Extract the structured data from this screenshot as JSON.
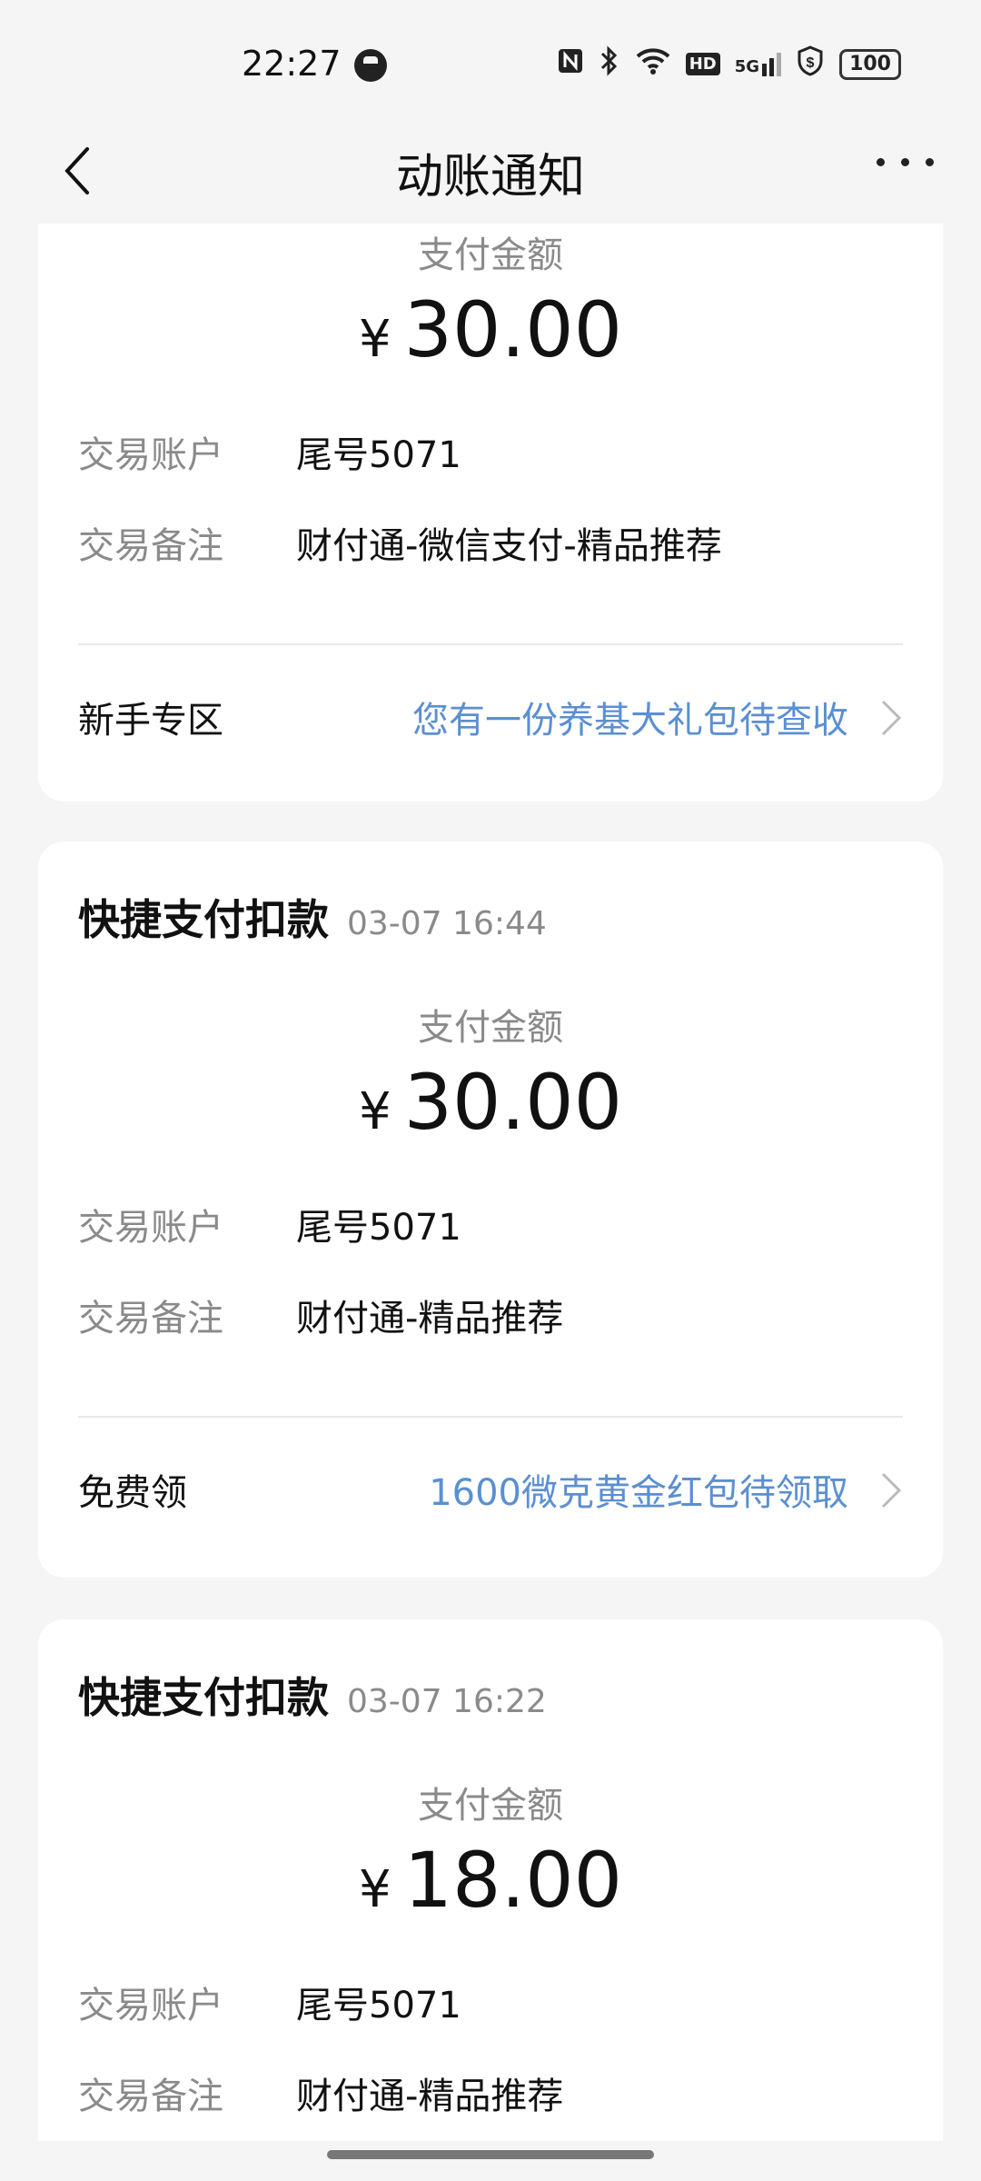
{
  "status_bar": {
    "time": "22:27",
    "icons": [
      "nfc-icon",
      "bluetooth-icon",
      "wifi-icon",
      "hd-icon",
      "5g-signal-icon",
      "shield-dollar-icon",
      "battery-icon"
    ],
    "hd_label": "HD",
    "signal_label": "5G",
    "battery": "100"
  },
  "nav": {
    "title": "动账通知"
  },
  "cards": [
    {
      "amount_label": "支付金额",
      "currency": "¥",
      "amount": "30.00",
      "account_label": "交易账户",
      "account_value": "尾号5071",
      "note_label": "交易备注",
      "note_value": "财付通-微信支付-精品推荐",
      "promo_label": "新手专区",
      "promo_text": "您有一份养基大礼包待查收"
    },
    {
      "type": "快捷支付扣款",
      "time": "03-07 16:44",
      "amount_label": "支付金额",
      "currency": "¥",
      "amount": "30.00",
      "account_label": "交易账户",
      "account_value": "尾号5071",
      "note_label": "交易备注",
      "note_value": "财付通-精品推荐",
      "promo_label": "免费领",
      "promo_text": "1600微克黄金红包待领取"
    },
    {
      "type": "快捷支付扣款",
      "time": "03-07 16:22",
      "amount_label": "支付金额",
      "currency": "¥",
      "amount": "18.00",
      "account_label": "交易账户",
      "account_value": "尾号5071",
      "note_label": "交易备注",
      "note_value": "财付通-精品推荐"
    }
  ],
  "colors": {
    "background": "#f5f5f5",
    "card": "#ffffff",
    "link": "#5b8fd1",
    "muted": "#8a8a8a"
  }
}
